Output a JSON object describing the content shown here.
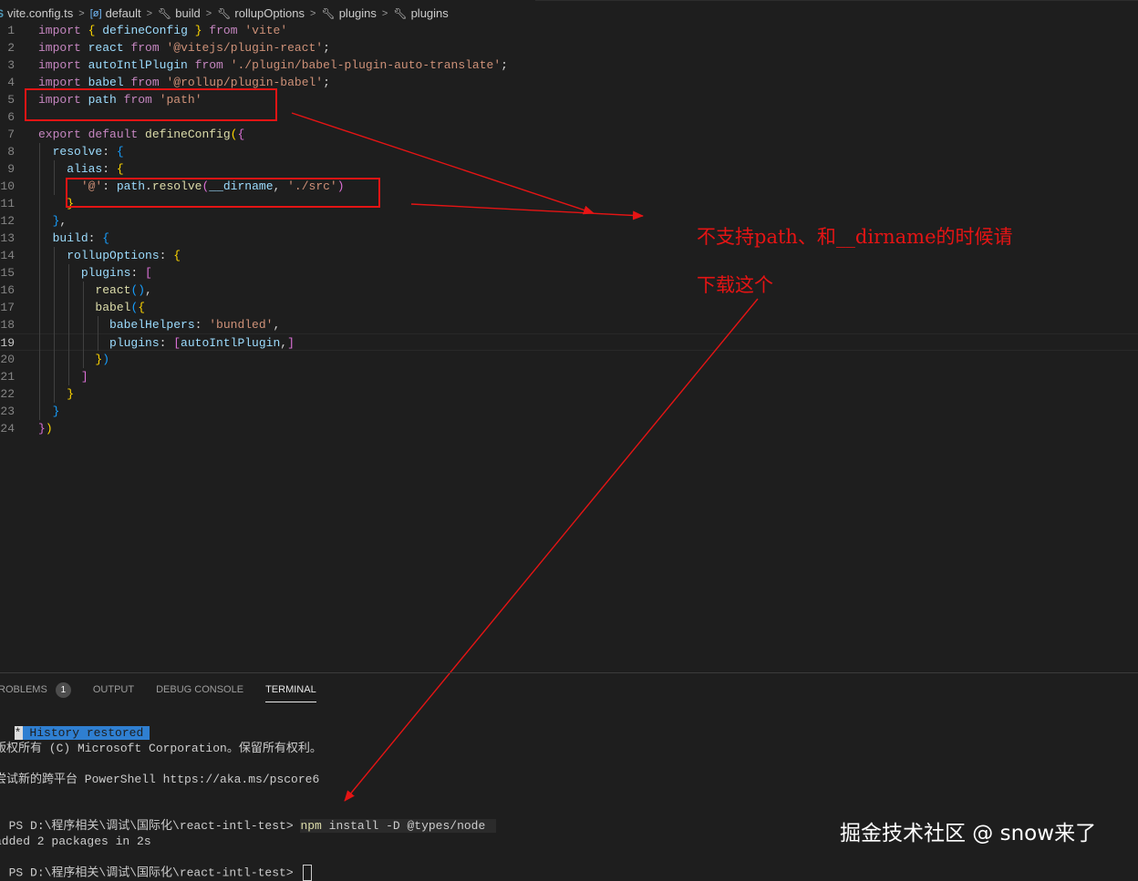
{
  "breadcrumb": {
    "ts_badge": "S",
    "file": "vite.config.ts",
    "sep": ">",
    "items": [
      "default",
      "build",
      "rollupOptions",
      "plugins",
      "plugins"
    ]
  },
  "editor": {
    "active_line": 19,
    "lines": [
      {
        "n": "1",
        "tokens": [
          [
            "t-kw",
            "import"
          ],
          [
            "t-plain",
            " "
          ],
          [
            "t-p1",
            "{"
          ],
          [
            "t-plain",
            " "
          ],
          [
            "t-var",
            "defineConfig"
          ],
          [
            "t-plain",
            " "
          ],
          [
            "t-p1",
            "}"
          ],
          [
            "t-plain",
            " "
          ],
          [
            "t-kw",
            "from"
          ],
          [
            "t-plain",
            " "
          ],
          [
            "t-str",
            "'vite'"
          ]
        ]
      },
      {
        "n": "2",
        "tokens": [
          [
            "t-kw",
            "import"
          ],
          [
            "t-plain",
            " "
          ],
          [
            "t-var",
            "react"
          ],
          [
            "t-plain",
            " "
          ],
          [
            "t-kw",
            "from"
          ],
          [
            "t-plain",
            " "
          ],
          [
            "t-str",
            "'@vitejs/plugin-react'"
          ],
          [
            "t-plain",
            ";"
          ]
        ]
      },
      {
        "n": "3",
        "tokens": [
          [
            "t-kw",
            "import"
          ],
          [
            "t-plain",
            " "
          ],
          [
            "t-var",
            "autoIntlPlugin"
          ],
          [
            "t-plain",
            " "
          ],
          [
            "t-kw",
            "from"
          ],
          [
            "t-plain",
            " "
          ],
          [
            "t-str",
            "'./plugin/babel-plugin-auto-translate'"
          ],
          [
            "t-plain",
            ";"
          ]
        ]
      },
      {
        "n": "4",
        "tokens": [
          [
            "t-kw",
            "import"
          ],
          [
            "t-plain",
            " "
          ],
          [
            "t-var",
            "babel"
          ],
          [
            "t-plain",
            " "
          ],
          [
            "t-kw",
            "from"
          ],
          [
            "t-plain",
            " "
          ],
          [
            "t-str",
            "'@rollup/plugin-babel'"
          ],
          [
            "t-plain",
            ";"
          ]
        ]
      },
      {
        "n": "5",
        "tokens": [
          [
            "t-kw",
            "import"
          ],
          [
            "t-plain",
            " "
          ],
          [
            "t-var",
            "path"
          ],
          [
            "t-plain",
            " "
          ],
          [
            "t-kw",
            "from"
          ],
          [
            "t-plain",
            " "
          ],
          [
            "t-str",
            "'path'"
          ]
        ]
      },
      {
        "n": "6",
        "tokens": []
      },
      {
        "n": "7",
        "tokens": [
          [
            "t-kw",
            "export"
          ],
          [
            "t-plain",
            " "
          ],
          [
            "t-kw",
            "default"
          ],
          [
            "t-plain",
            " "
          ],
          [
            "t-fn",
            "defineConfig"
          ],
          [
            "t-p1",
            "("
          ],
          [
            "t-p2",
            "{"
          ]
        ]
      },
      {
        "n": "8",
        "tokens": [
          [
            "t-plain",
            "  "
          ],
          [
            "t-var",
            "resolve"
          ],
          [
            "t-plain",
            ": "
          ],
          [
            "t-p3",
            "{"
          ]
        ]
      },
      {
        "n": "9",
        "tokens": [
          [
            "t-plain",
            "    "
          ],
          [
            "t-var",
            "alias"
          ],
          [
            "t-plain",
            ": "
          ],
          [
            "t-p1",
            "{"
          ]
        ]
      },
      {
        "n": "10",
        "tokens": [
          [
            "t-plain",
            "      "
          ],
          [
            "t-str",
            "'@'"
          ],
          [
            "t-plain",
            ": "
          ],
          [
            "t-var",
            "path"
          ],
          [
            "t-plain",
            "."
          ],
          [
            "t-fn",
            "resolve"
          ],
          [
            "t-p2",
            "("
          ],
          [
            "t-var",
            "__dirname"
          ],
          [
            "t-plain",
            ", "
          ],
          [
            "t-str",
            "'./src'"
          ],
          [
            "t-p2",
            ")"
          ]
        ]
      },
      {
        "n": "11",
        "tokens": [
          [
            "t-plain",
            "    "
          ],
          [
            "t-p1",
            "}"
          ]
        ]
      },
      {
        "n": "12",
        "tokens": [
          [
            "t-plain",
            "  "
          ],
          [
            "t-p3",
            "}"
          ],
          [
            "t-plain",
            ","
          ]
        ]
      },
      {
        "n": "13",
        "tokens": [
          [
            "t-plain",
            "  "
          ],
          [
            "t-var",
            "build"
          ],
          [
            "t-plain",
            ": "
          ],
          [
            "t-p3",
            "{"
          ]
        ]
      },
      {
        "n": "14",
        "tokens": [
          [
            "t-plain",
            "    "
          ],
          [
            "t-var",
            "rollupOptions"
          ],
          [
            "t-plain",
            ": "
          ],
          [
            "t-p1",
            "{"
          ]
        ]
      },
      {
        "n": "15",
        "tokens": [
          [
            "t-plain",
            "      "
          ],
          [
            "t-var",
            "plugins"
          ],
          [
            "t-plain",
            ": "
          ],
          [
            "t-p2",
            "["
          ]
        ]
      },
      {
        "n": "16",
        "tokens": [
          [
            "t-plain",
            "        "
          ],
          [
            "t-fn",
            "react"
          ],
          [
            "t-p3",
            "()"
          ],
          [
            "t-plain",
            ","
          ]
        ]
      },
      {
        "n": "17",
        "tokens": [
          [
            "t-plain",
            "        "
          ],
          [
            "t-fn",
            "babel"
          ],
          [
            "t-p3",
            "("
          ],
          [
            "t-p1",
            "{"
          ]
        ]
      },
      {
        "n": "18",
        "tokens": [
          [
            "t-plain",
            "          "
          ],
          [
            "t-var",
            "babelHelpers"
          ],
          [
            "t-plain",
            ": "
          ],
          [
            "t-str",
            "'bundled'"
          ],
          [
            "t-plain",
            ","
          ]
        ]
      },
      {
        "n": "19",
        "tokens": [
          [
            "t-plain",
            "          "
          ],
          [
            "t-var",
            "plugins"
          ],
          [
            "t-plain",
            ": "
          ],
          [
            "t-p2",
            "["
          ],
          [
            "t-var",
            "autoIntlPlugin"
          ],
          [
            "t-plain",
            ","
          ],
          [
            "t-p2",
            "]"
          ]
        ]
      },
      {
        "n": "20",
        "tokens": [
          [
            "t-plain",
            "        "
          ],
          [
            "t-p1",
            "}"
          ],
          [
            "t-p3",
            ")"
          ]
        ]
      },
      {
        "n": "21",
        "tokens": [
          [
            "t-plain",
            "      "
          ],
          [
            "t-p2",
            "]"
          ]
        ]
      },
      {
        "n": "22",
        "tokens": [
          [
            "t-plain",
            "    "
          ],
          [
            "t-p1",
            "}"
          ]
        ]
      },
      {
        "n": "23",
        "tokens": [
          [
            "t-plain",
            "  "
          ],
          [
            "t-p3",
            "}"
          ]
        ]
      },
      {
        "n": "24",
        "tokens": [
          [
            "t-p2",
            "}"
          ],
          [
            "t-p1",
            ")"
          ]
        ]
      }
    ]
  },
  "annotation": {
    "line1": "不支持path、和__dirname的时候请",
    "line2": "下载这个",
    "color": "#e51414"
  },
  "panel": {
    "tabs": [
      {
        "label": "ROBLEMS",
        "badge": "1"
      },
      {
        "label": "OUTPUT"
      },
      {
        "label": "DEBUG CONSOLE"
      },
      {
        "label": "TERMINAL",
        "active": true
      }
    ]
  },
  "terminal": {
    "history_star": "*",
    "history": "History restored",
    "copyright": "版权所有 (C) Microsoft Corporation。保留所有权利。",
    "try_new": "尝试新的跨平台 PowerShell https://aka.ms/pscore6",
    "prompt1": "PS D:\\程序相关\\调试\\国际化\\react-intl-test> ",
    "cmd_npm": "npm",
    "cmd_rest": " install -D @types/node ",
    "added": "added 2 packages in 2s",
    "prompt2": "PS D:\\程序相关\\调试\\国际化\\react-intl-test> "
  },
  "watermark": "掘金技术社区 @ snow来了"
}
